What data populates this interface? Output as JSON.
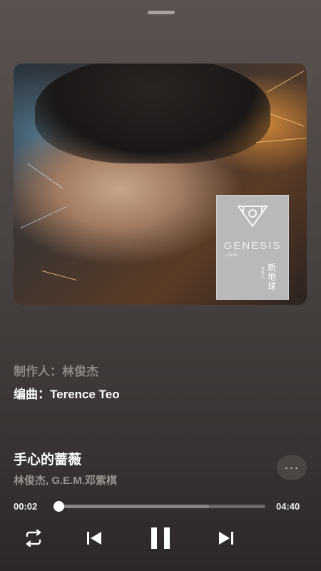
{
  "album": {
    "title": "GENESIS",
    "artist_tag": "JJ LIN",
    "chinese_title": "新地球",
    "chinese_artist": "林俊杰"
  },
  "credits": {
    "producer": "制作人：林俊杰",
    "arranger": "编曲：Terence Teo"
  },
  "track": {
    "title": "手心的蔷薇",
    "artists": "林俊杰, G.E.M.邓紫棋"
  },
  "playback": {
    "current_time": "00:02",
    "total_time": "04:40",
    "progress_fraction": 0.007,
    "buffered_fraction": 0.73
  },
  "controls": {
    "more_label": "···"
  },
  "icons": [
    "drag-handle-icon",
    "more-icon",
    "repeat-icon",
    "previous-icon",
    "pause-icon",
    "next-icon"
  ]
}
